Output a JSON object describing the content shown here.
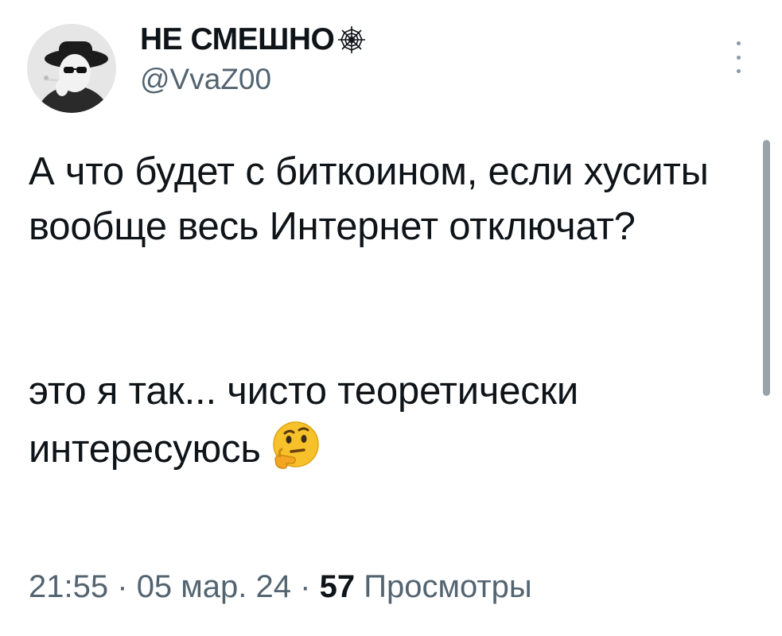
{
  "author": {
    "display_name": "НЕ СМЕШНО",
    "handle": "@VvaZ00",
    "badge_icon": "spider-web-icon"
  },
  "more_icon": "more-vertical-icon",
  "tweet": {
    "paragraph1": "А что будет с биткоином, если хуситы вообще весь Интернет отключат?",
    "paragraph2": "это я так... чисто теоретически интересуюсь",
    "emoji": "thinking-face-emoji"
  },
  "meta": {
    "time": "21:55",
    "separator1": "·",
    "date": "05 мар. 24",
    "separator2": "·",
    "views_count": "57",
    "views_label": "Просмотры"
  },
  "colors": {
    "text": "#0f1419",
    "secondary": "#536471",
    "emoji_face": "#f7c12b"
  }
}
